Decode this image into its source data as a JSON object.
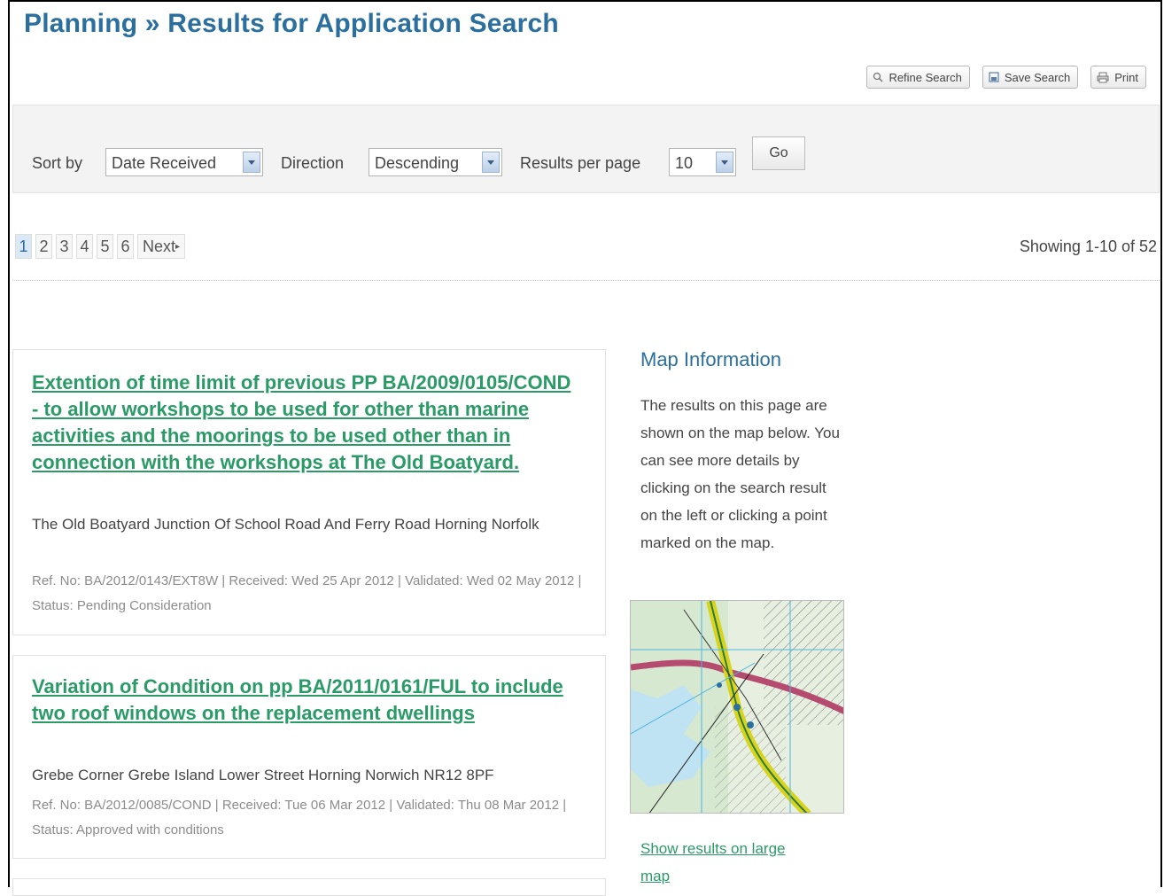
{
  "title": "Planning » Results for Application Search",
  "toolbar": {
    "refine_label": "Refine Search",
    "save_label": "Save Search",
    "print_label": "Print"
  },
  "sort": {
    "sort_by_label": "Sort by",
    "sort_by_value": "Date Received",
    "direction_label": "Direction",
    "direction_value": "Descending",
    "per_page_label": "Results per page",
    "per_page_value": "10",
    "go_label": "Go"
  },
  "pager": {
    "pages": [
      "1",
      "2",
      "3",
      "4",
      "5",
      "6"
    ],
    "next_label": "Next",
    "showing": "Showing 1-10 of 52"
  },
  "results": [
    {
      "title": "Extention of time limit of previous PP BA/2009/0105/COND - to allow workshops to be used for other than marine activities and the moorings to be used other than in connection with the workshops at The Old Boatyard.",
      "address": "The Old Boatyard Junction Of School Road And Ferry Road Horning Norfolk",
      "meta": "Ref. No: BA/2012/0143/EXT8W | Received: Wed 25 Apr 2012 | Validated: Wed 02 May 2012 | Status: Pending Consideration"
    },
    {
      "title": "Variation of Condition on pp BA/2011/0161/FUL to include two roof windows on the replacement dwellings",
      "address": "Grebe Corner Grebe Island Lower Street Horning Norwich NR12 8PF",
      "meta": "Ref. No: BA/2012/0085/COND | Received: Tue 06 Mar 2012 | Validated: Thu 08 Mar 2012 | Status: Approved with conditions"
    }
  ],
  "map": {
    "heading": "Map Information",
    "text": "The results on this page are shown on the map below. You can see more details by clicking on the search result on the left or clicking a point marked on the map.",
    "link": "Show results on large map"
  }
}
